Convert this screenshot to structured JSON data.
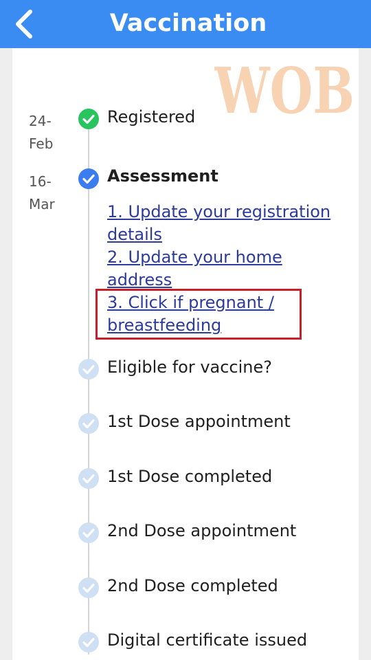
{
  "header": {
    "title": "Vaccination",
    "back_icon": "chevron-left-icon",
    "background": "#3b8cf2"
  },
  "watermark": {
    "text": "WOB"
  },
  "timeline": {
    "steps": [
      {
        "label": "Registered",
        "date_day": "24-",
        "date_month": "Feb",
        "status": "done",
        "icon": "check-circle-icon",
        "color": "#28c55e"
      },
      {
        "label": "Assessment",
        "date_day": "16-",
        "date_month": "Mar",
        "status": "current",
        "icon": "check-circle-icon",
        "color": "#3b7cf0"
      },
      {
        "label": "Eligible for vaccine?",
        "status": "pending",
        "icon": "check-circle-icon"
      },
      {
        "label": "1st Dose appointment",
        "status": "pending",
        "icon": "check-circle-icon"
      },
      {
        "label": "1st Dose completed",
        "status": "pending",
        "icon": "check-circle-icon"
      },
      {
        "label": "2nd Dose appointment",
        "status": "pending",
        "icon": "check-circle-icon"
      },
      {
        "label": "2nd Dose completed",
        "status": "pending",
        "icon": "check-circle-icon"
      },
      {
        "label": "Digital certificate issued",
        "status": "pending",
        "icon": "check-circle-icon"
      }
    ],
    "pending_color": "#cfe0f5"
  },
  "assessment_links": {
    "link1": "1. Update your registration details",
    "link2": "2. Update your home address",
    "link3": "3. Click if pregnant / breastfeeding"
  },
  "highlight_color": "#c8202b"
}
